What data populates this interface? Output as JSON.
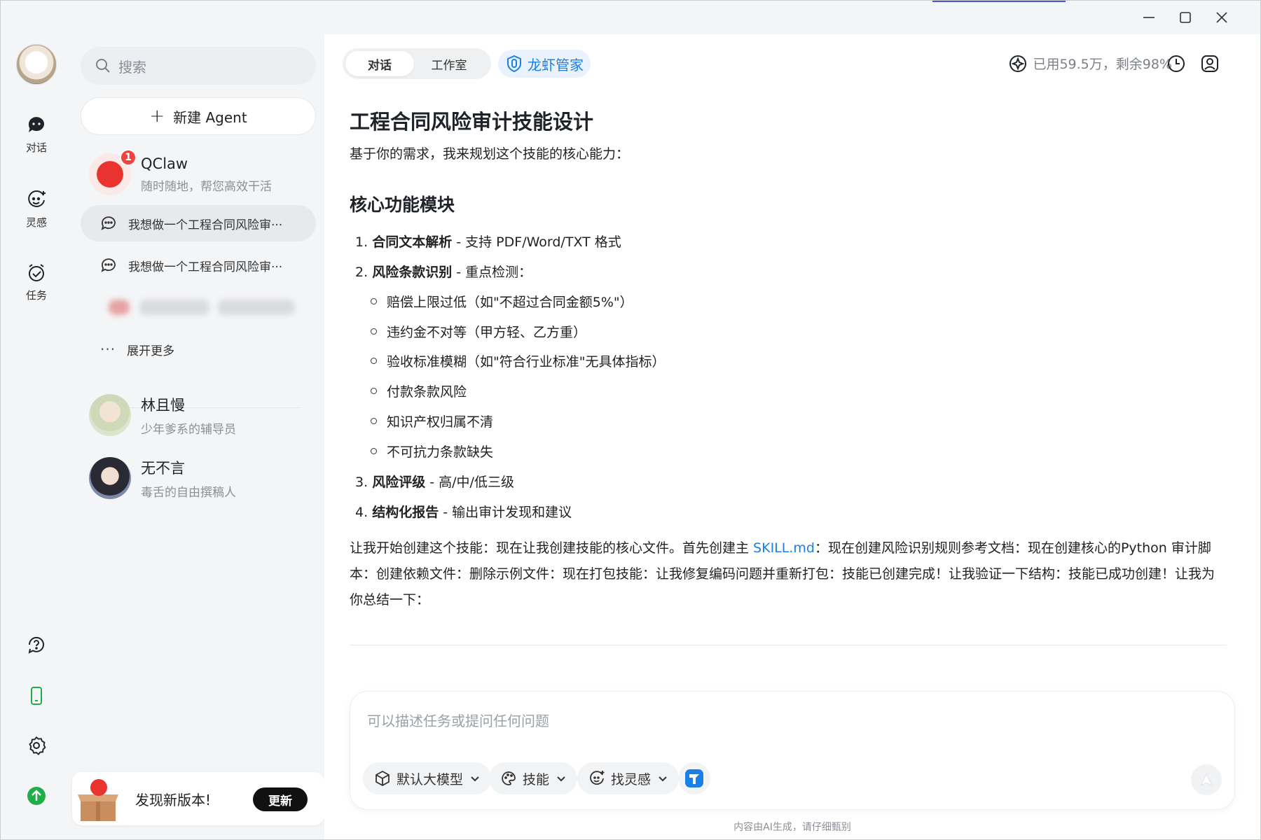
{
  "rail": {
    "items": [
      {
        "label": "对话",
        "icon": "chat-icon"
      },
      {
        "label": "灵感",
        "icon": "inspiration-icon"
      },
      {
        "label": "任务",
        "icon": "task-icon"
      }
    ],
    "bottom_icons": [
      "help-icon",
      "phone-icon",
      "settings-icon",
      "upgrade-icon"
    ]
  },
  "sidebar": {
    "search_placeholder": "搜索",
    "new_agent_label": "新建 Agent",
    "agents_top": [
      {
        "name": "QClaw",
        "subtitle": "随时随地，帮您高效干活",
        "badge": "1"
      }
    ],
    "conversations": [
      {
        "title": "我想做一个工程合同风险审···",
        "active": true
      },
      {
        "title": "我想做一个工程合同风险审···",
        "active": false
      }
    ],
    "expand_more": "展开更多",
    "agents": [
      {
        "name": "林且慢",
        "subtitle": "少年爹系的辅导员"
      },
      {
        "name": "无不言",
        "subtitle": "毒舌的自由撰稿人"
      }
    ],
    "update": {
      "message": "发现新版本!",
      "button": "更新"
    }
  },
  "header": {
    "tabs": [
      "对话",
      "工作室"
    ],
    "active_tab": "对话",
    "steward_label": "龙虾管家",
    "usage_text": "已用59.5万，剩余98%"
  },
  "article": {
    "title": "工程合同风险审计技能设计",
    "intro": "基于你的需求，我来规划这个技能的核心能力：",
    "section_title": "核心功能模块",
    "items": [
      {
        "num": "1.",
        "bold": "合同文本解析",
        "rest": " - 支持 PDF/Word/TXT 格式"
      },
      {
        "num": "2.",
        "bold": "风险条款识别",
        "rest": " - 重点检测："
      },
      {
        "num": "3.",
        "bold": "风险评级",
        "rest": " - 高/中/低三级"
      },
      {
        "num": "4.",
        "bold": "结构化报告",
        "rest": " - 输出审计发现和建议"
      }
    ],
    "sub_items": [
      "赔偿上限过低（如\"不超过合同金额5%\"）",
      "违约金不对等（甲方轻、乙方重）",
      "验收标准模糊（如\"符合行业标准\"无具体指标）",
      "付款条款风险",
      "知识产权归属不清",
      "不可抗力条款缺失"
    ],
    "para_before_link": "让我开始创建这个技能：现在让我创建技能的核心文件。首先创建主 ",
    "para_link": "SKILL.md",
    "para_after_link": "：现在创建风险识别规则参考文档：现在创建核心的Python 审计脚本：创建依赖文件：删除示例文件：现在打包技能：让我修复编码问题并重新打包：技能已创建完成！让我验证一下结构：技能已成功创建！让我为你总结一下："
  },
  "composer": {
    "placeholder": "可以描述任务或提问任何问题",
    "chips": [
      "默认大模型",
      "技能",
      "找灵感"
    ]
  },
  "footer": {
    "disclaimer": "内容由AI生成，请仔细甄别"
  },
  "colors": {
    "accent": "#1b7fe8",
    "badge": "#f2433d",
    "upgrade": "#1fae4a"
  }
}
